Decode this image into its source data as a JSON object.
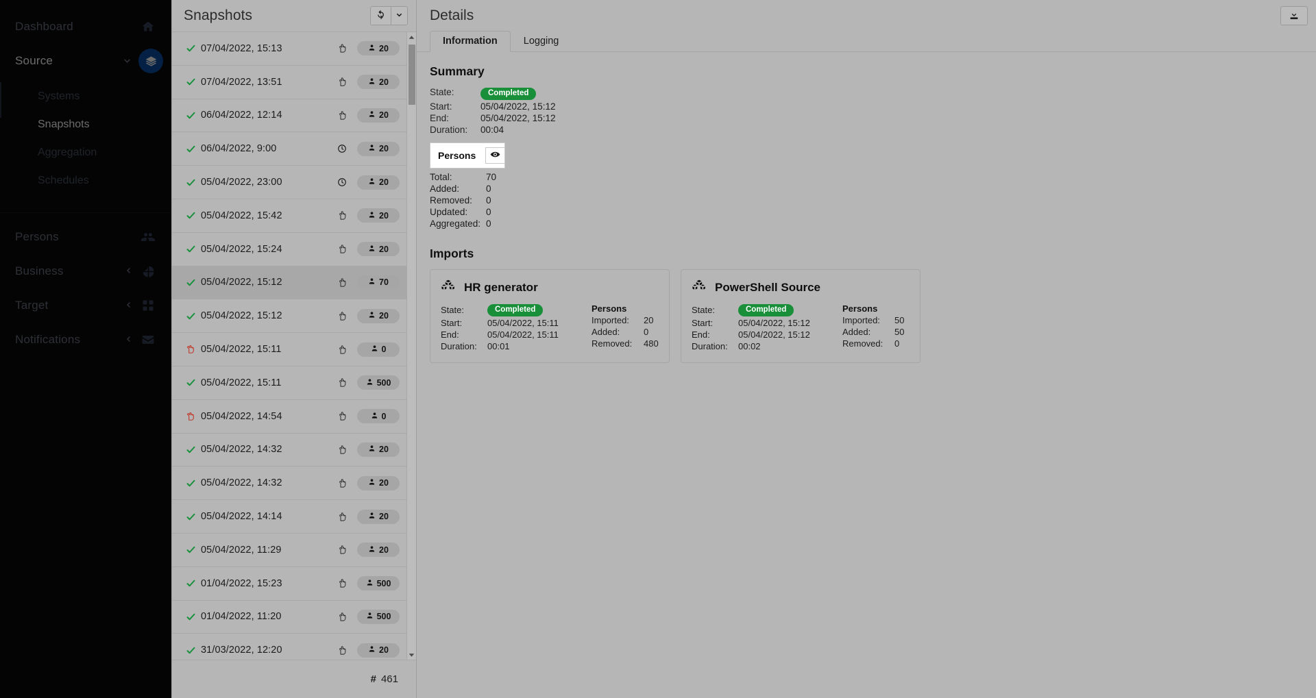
{
  "sidebar": {
    "items": [
      {
        "label": "Dashboard",
        "icon": "home-icon",
        "state": "normal"
      },
      {
        "label": "Source",
        "icon": "layers-icon",
        "state": "expanded"
      },
      {
        "label": "Persons",
        "icon": "people-icon",
        "state": "normal"
      },
      {
        "label": "Business",
        "icon": "pie-chart-icon",
        "state": "collapsible"
      },
      {
        "label": "Target",
        "icon": "grid-icon",
        "state": "collapsible"
      },
      {
        "label": "Notifications",
        "icon": "envelope-icon",
        "state": "collapsible"
      }
    ],
    "source_children": [
      {
        "label": "Systems",
        "selected": false
      },
      {
        "label": "Snapshots",
        "selected": true
      },
      {
        "label": "Aggregation",
        "selected": false
      },
      {
        "label": "Schedules",
        "selected": false
      }
    ]
  },
  "list_panel": {
    "title": "Snapshots",
    "refresh_icon": "refresh-icon",
    "caret_icon": "chevron-down-icon",
    "count_prefix": "#",
    "count": "461",
    "rows": [
      {
        "status": "ok",
        "date": "07/04/2022, 15:13",
        "trigger": "manual",
        "persons": "20",
        "selected": false
      },
      {
        "status": "ok",
        "date": "07/04/2022, 13:51",
        "trigger": "manual",
        "persons": "20",
        "selected": false
      },
      {
        "status": "ok",
        "date": "06/04/2022, 12:14",
        "trigger": "manual",
        "persons": "20",
        "selected": false
      },
      {
        "status": "ok",
        "date": "06/04/2022, 9:00",
        "trigger": "scheduled",
        "persons": "20",
        "selected": false
      },
      {
        "status": "ok",
        "date": "05/04/2022, 23:00",
        "trigger": "scheduled",
        "persons": "20",
        "selected": false
      },
      {
        "status": "ok",
        "date": "05/04/2022, 15:42",
        "trigger": "manual",
        "persons": "20",
        "selected": false
      },
      {
        "status": "ok",
        "date": "05/04/2022, 15:24",
        "trigger": "manual",
        "persons": "20",
        "selected": false
      },
      {
        "status": "ok",
        "date": "05/04/2022, 15:12",
        "trigger": "manual",
        "persons": "70",
        "selected": true
      },
      {
        "status": "ok",
        "date": "05/04/2022, 15:12",
        "trigger": "manual",
        "persons": "20",
        "selected": false
      },
      {
        "status": "error",
        "date": "05/04/2022, 15:11",
        "trigger": "manual",
        "persons": "0",
        "selected": false
      },
      {
        "status": "ok",
        "date": "05/04/2022, 15:11",
        "trigger": "manual",
        "persons": "500",
        "selected": false
      },
      {
        "status": "error",
        "date": "05/04/2022, 14:54",
        "trigger": "manual",
        "persons": "0",
        "selected": false
      },
      {
        "status": "ok",
        "date": "05/04/2022, 14:32",
        "trigger": "manual",
        "persons": "20",
        "selected": false
      },
      {
        "status": "ok",
        "date": "05/04/2022, 14:32",
        "trigger": "manual",
        "persons": "20",
        "selected": false
      },
      {
        "status": "ok",
        "date": "05/04/2022, 14:14",
        "trigger": "manual",
        "persons": "20",
        "selected": false
      },
      {
        "status": "ok",
        "date": "05/04/2022, 11:29",
        "trigger": "manual",
        "persons": "20",
        "selected": false
      },
      {
        "status": "ok",
        "date": "01/04/2022, 15:23",
        "trigger": "manual",
        "persons": "500",
        "selected": false
      },
      {
        "status": "ok",
        "date": "01/04/2022, 11:20",
        "trigger": "manual",
        "persons": "500",
        "selected": false
      },
      {
        "status": "ok",
        "date": "31/03/2022, 12:20",
        "trigger": "manual",
        "persons": "20",
        "selected": false
      }
    ]
  },
  "details": {
    "title": "Details",
    "download_icon": "download-icon",
    "tabs": [
      {
        "label": "Information",
        "active": true
      },
      {
        "label": "Logging",
        "active": false
      }
    ],
    "summary": {
      "heading": "Summary",
      "state_label": "State:",
      "state_value": "Completed",
      "start_label": "Start:",
      "start_value": "05/04/2022, 15:12",
      "end_label": "End:",
      "end_value": "05/04/2022, 15:12",
      "duration_label": "Duration:",
      "duration_value": "00:04"
    },
    "persons_card": {
      "title": "Persons",
      "eye_icon": "eye-icon",
      "rows": [
        {
          "label": "Total:",
          "value": "70"
        },
        {
          "label": "Added:",
          "value": "0"
        },
        {
          "label": "Removed:",
          "value": "0"
        },
        {
          "label": "Updated:",
          "value": "0"
        },
        {
          "label": "Aggregated:",
          "value": "0"
        }
      ]
    },
    "imports": {
      "heading": "Imports",
      "cards": [
        {
          "icon": "boxes-icon",
          "name": "HR generator",
          "state_label": "State:",
          "state_value": "Completed",
          "start_label": "Start:",
          "start_value": "05/04/2022, 15:11",
          "end_label": "End:",
          "end_value": "05/04/2022, 15:11",
          "duration_label": "Duration:",
          "duration_value": "00:01",
          "persons_heading": "Persons",
          "persons_rows": [
            {
              "label": "Imported:",
              "value": "20"
            },
            {
              "label": "Added:",
              "value": "0"
            },
            {
              "label": "Removed:",
              "value": "480"
            }
          ]
        },
        {
          "icon": "boxes-icon",
          "name": "PowerShell Source",
          "state_label": "State:",
          "state_value": "Completed",
          "start_label": "Start:",
          "start_value": "05/04/2022, 15:12",
          "end_label": "End:",
          "end_value": "05/04/2022, 15:12",
          "duration_label": "Duration:",
          "duration_value": "00:02",
          "persons_heading": "Persons",
          "persons_rows": [
            {
              "label": "Imported:",
              "value": "50"
            },
            {
              "label": "Added:",
              "value": "50"
            },
            {
              "label": "Removed:",
              "value": "0"
            }
          ]
        }
      ]
    }
  },
  "colors": {
    "accent": "#0b4da2",
    "success": "#198f3a",
    "error": "#c0392b",
    "sidebar_bg": "#0a0a0a",
    "page_bg": "#b6b6b6"
  }
}
